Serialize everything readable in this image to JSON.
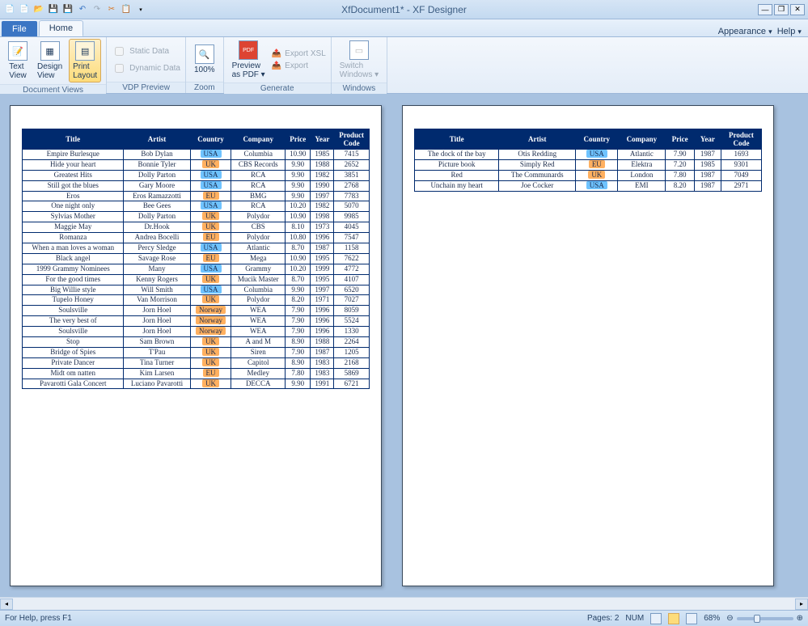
{
  "title": "XfDocument1* - XF Designer",
  "tabs": {
    "file": "File",
    "home": "Home"
  },
  "right_links": {
    "appearance": "Appearance",
    "help": "Help"
  },
  "ribbon": {
    "doc_views": {
      "label": "Document Views",
      "text_view": "Text\nView",
      "design_view": "Design\nView",
      "print_layout": "Print\nLayout"
    },
    "vdp": {
      "label": "VDP Preview",
      "static": "Static Data",
      "dynamic": "Dynamic Data"
    },
    "zoom": {
      "label": "Zoom",
      "pct": "100%"
    },
    "generate": {
      "label": "Generate",
      "preview_pdf": "Preview\nas PDF",
      "export_xsl": "Export XSL",
      "export": "Export"
    },
    "windows": {
      "label": "Windows",
      "switch": "Switch\nWindows"
    }
  },
  "status": {
    "help": "For Help, press F1",
    "pages": "Pages: 2",
    "num": "NUM",
    "zoom": "68%"
  },
  "headers": [
    "Title",
    "Artist",
    "Country",
    "Company",
    "Price",
    "Year",
    "Product Code"
  ],
  "rows1": [
    [
      "Empire Burlesque",
      "Bob Dylan",
      "USA",
      "Columbia",
      "10.90",
      "1985",
      "7415"
    ],
    [
      "Hide your heart",
      "Bonnie Tyler",
      "UK",
      "CBS Records",
      "9.90",
      "1988",
      "2652"
    ],
    [
      "Greatest Hits",
      "Dolly Parton",
      "USA",
      "RCA",
      "9.90",
      "1982",
      "3851"
    ],
    [
      "Still got the blues",
      "Gary Moore",
      "USA",
      "RCA",
      "9.90",
      "1990",
      "2768"
    ],
    [
      "Eros",
      "Eros Ramazzotti",
      "EU",
      "BMG",
      "9.90",
      "1997",
      "7783"
    ],
    [
      "One night only",
      "Bee Gees",
      "USA",
      "RCA",
      "10.20",
      "1982",
      "5070"
    ],
    [
      "Sylvias Mother",
      "Dolly Parton",
      "UK",
      "Polydor",
      "10.90",
      "1998",
      "9985"
    ],
    [
      "Maggie May",
      "Dr.Hook",
      "UK",
      "CBS",
      "8.10",
      "1973",
      "4045"
    ],
    [
      "Romanza",
      "Andrea Bocelli",
      "EU",
      "Polydor",
      "10.80",
      "1996",
      "7547"
    ],
    [
      "When a man loves a woman",
      "Percy Sledge",
      "USA",
      "Atlantic",
      "8.70",
      "1987",
      "1158"
    ],
    [
      "Black angel",
      "Savage Rose",
      "EU",
      "Mega",
      "10.90",
      "1995",
      "7622"
    ],
    [
      "1999 Grammy Nominees",
      "Many",
      "USA",
      "Grammy",
      "10.20",
      "1999",
      "4772"
    ],
    [
      "For the good times",
      "Kenny Rogers",
      "UK",
      "Mucik Master",
      "8.70",
      "1995",
      "4107"
    ],
    [
      "Big Willie style",
      "Will Smith",
      "USA",
      "Columbia",
      "9.90",
      "1997",
      "6520"
    ],
    [
      "Tupelo Honey",
      "Van Morrison",
      "UK",
      "Polydor",
      "8.20",
      "1971",
      "7027"
    ],
    [
      "Soulsville",
      "Jorn Hoel",
      "Norway",
      "WEA",
      "7.90",
      "1996",
      "8059"
    ],
    [
      "The very best of",
      "Jorn Hoel",
      "Norway",
      "WEA",
      "7.90",
      "1996",
      "5524"
    ],
    [
      "Soulsville",
      "Jorn Hoel",
      "Norway",
      "WEA",
      "7.90",
      "1996",
      "1330"
    ],
    [
      "Stop",
      "Sam Brown",
      "UK",
      "A and M",
      "8.90",
      "1988",
      "2264"
    ],
    [
      "Bridge of Spies",
      "T'Pau",
      "UK",
      "Siren",
      "7.90",
      "1987",
      "1205"
    ],
    [
      "Private Dancer",
      "Tina Turner",
      "UK",
      "Capitol",
      "8.90",
      "1983",
      "2168"
    ],
    [
      "Midt om natten",
      "Kim Larsen",
      "EU",
      "Medley",
      "7.80",
      "1983",
      "5869"
    ],
    [
      "Pavarotti Gala Concert",
      "Luciano Pavarotti",
      "UK",
      "DECCA",
      "9.90",
      "1991",
      "6721"
    ]
  ],
  "rows2": [
    [
      "The dock of the bay",
      "Otis Redding",
      "USA",
      "Atlantic",
      "7.90",
      "1987",
      "1693"
    ],
    [
      "Picture book",
      "Simply Red",
      "EU",
      "Elektra",
      "7.20",
      "1985",
      "9301"
    ],
    [
      "Red",
      "The Communards",
      "UK",
      "London",
      "7.80",
      "1987",
      "7049"
    ],
    [
      "Unchain my heart",
      "Joe Cocker",
      "USA",
      "EMI",
      "8.20",
      "1987",
      "2971"
    ]
  ]
}
